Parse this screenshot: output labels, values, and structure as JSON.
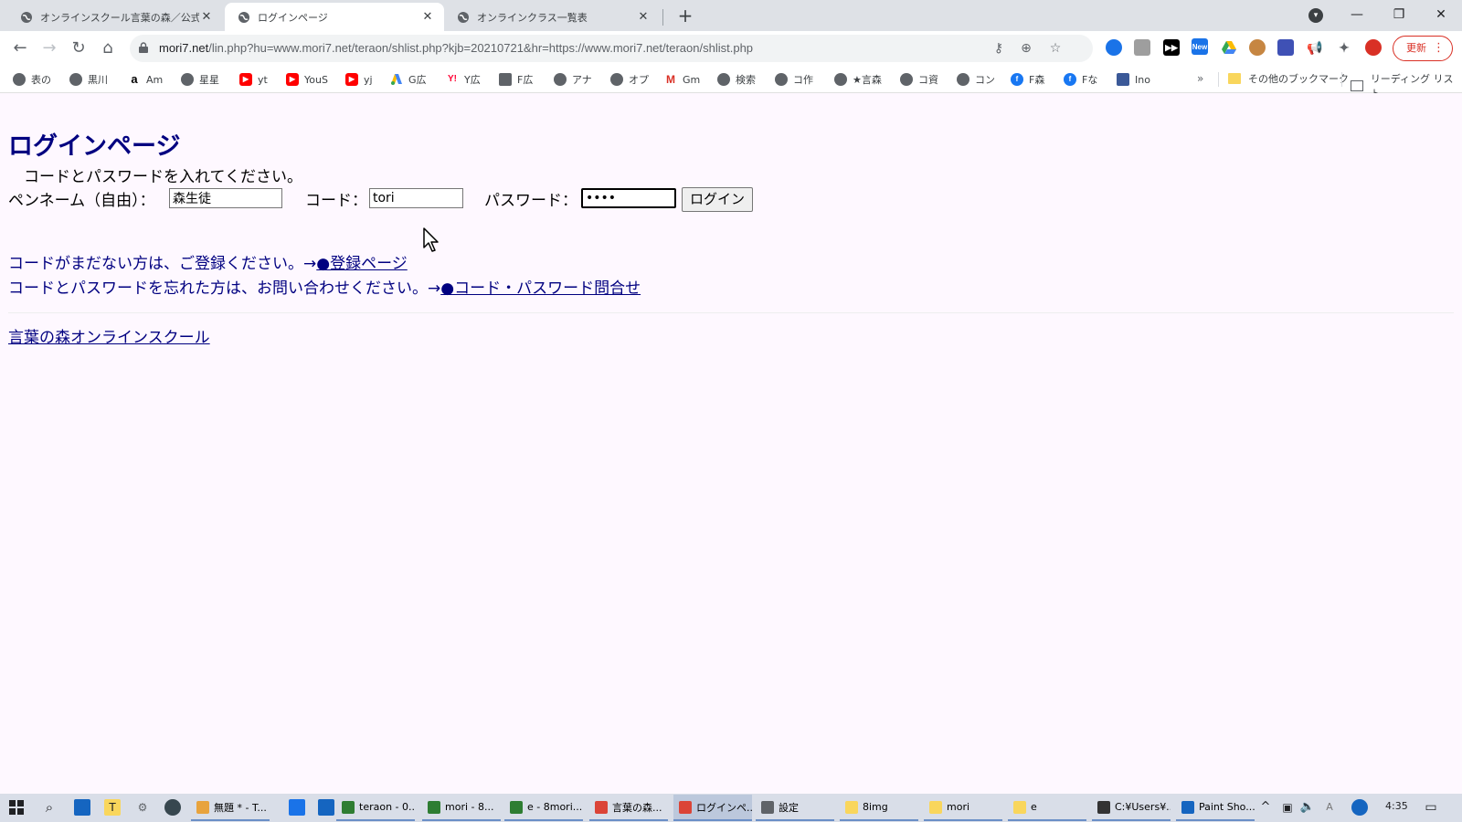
{
  "browser": {
    "tabs": [
      {
        "title": "オンラインスクール言葉の森／公式ホ",
        "active": false
      },
      {
        "title": "ログインページ",
        "active": true
      },
      {
        "title": "オンラインクラス一覧表",
        "active": false
      }
    ],
    "new_tab": "+",
    "window_buttons": {
      "minimize": "—",
      "restore": "❐",
      "close": "✕"
    },
    "url_host": "mori7.net",
    "url_path": "/lin.php?hu=www.mori7.net/teraon/shlist.php?kjb=20210721&hr=https://www.mori7.net/teraon/shlist.php",
    "update_label": "更新",
    "extension_new_badge": "New"
  },
  "bookmarks": [
    {
      "label": "表の",
      "icon": "globe"
    },
    {
      "label": "黒川",
      "icon": "globe"
    },
    {
      "label": "Am",
      "icon": "amazon"
    },
    {
      "label": "星星",
      "icon": "globe"
    },
    {
      "label": "yt",
      "icon": "youtube"
    },
    {
      "label": "YouS",
      "icon": "youtube"
    },
    {
      "label": "yj",
      "icon": "youtube"
    },
    {
      "label": "G広",
      "icon": "google-ads"
    },
    {
      "label": "Y広",
      "icon": "yahoo"
    },
    {
      "label": "F広",
      "icon": "doc"
    },
    {
      "label": "アナ",
      "icon": "globe"
    },
    {
      "label": "オプ",
      "icon": "globe"
    },
    {
      "label": "Gm",
      "icon": "gmail"
    },
    {
      "label": "検索",
      "icon": "globe"
    },
    {
      "label": "コ作",
      "icon": "globe"
    },
    {
      "label": "★言森",
      "icon": "globe"
    },
    {
      "label": "コ資",
      "icon": "globe"
    },
    {
      "label": "コン",
      "icon": "globe"
    },
    {
      "label": "F森",
      "icon": "facebook"
    },
    {
      "label": "Fな",
      "icon": "facebook"
    },
    {
      "label": "Ino",
      "icon": "ino"
    }
  ],
  "bookmarks_more": "»",
  "bookmarks_folder": "その他のブックマーク",
  "reading_list": "リーディング リスト",
  "page": {
    "title": "ログインページ",
    "instruction": "コードとパスワードを入れてください。",
    "penname_label": "ペンネーム（自由）：",
    "penname_value": "森生徒",
    "code_label": "コード：",
    "code_value": "tori",
    "password_label": "パスワード：",
    "password_value": "••••",
    "login_button": "ログイン",
    "register_text": "コードがまだない方は、ご登録ください。→",
    "register_link": "●登録ページ",
    "forgot_text": "コードとパスワードを忘れた方は、お問い合わせください。→",
    "forgot_link": "●コード・パスワード問合せ",
    "footer_link": "言葉の森オンラインスクール"
  },
  "taskbar": {
    "items": [
      {
        "label": "無題 * - T...",
        "active": false,
        "color": "#e8a33d"
      },
      {
        "label": "teraon - 0...",
        "active": false,
        "color": "#2e7d32"
      },
      {
        "label": "mori - 8...",
        "active": false,
        "color": "#2e7d32"
      },
      {
        "label": "e - 8mori...",
        "active": false,
        "color": "#2e7d32"
      },
      {
        "label": "言葉の森...",
        "active": false,
        "color": "#db4437"
      },
      {
        "label": "ログインペ...",
        "active": true,
        "color": "#db4437"
      },
      {
        "label": "設定",
        "active": false,
        "color": "#5f6368"
      },
      {
        "label": "8img",
        "active": false,
        "color": "#f9d65c"
      },
      {
        "label": "mori",
        "active": false,
        "color": "#f9d65c"
      },
      {
        "label": "e",
        "active": false,
        "color": "#f9d65c"
      },
      {
        "label": "C:¥Users¥...",
        "active": false,
        "color": "#333333"
      },
      {
        "label": "Paint Sho...",
        "active": false,
        "color": "#1565c0"
      }
    ],
    "time": "4:35"
  }
}
